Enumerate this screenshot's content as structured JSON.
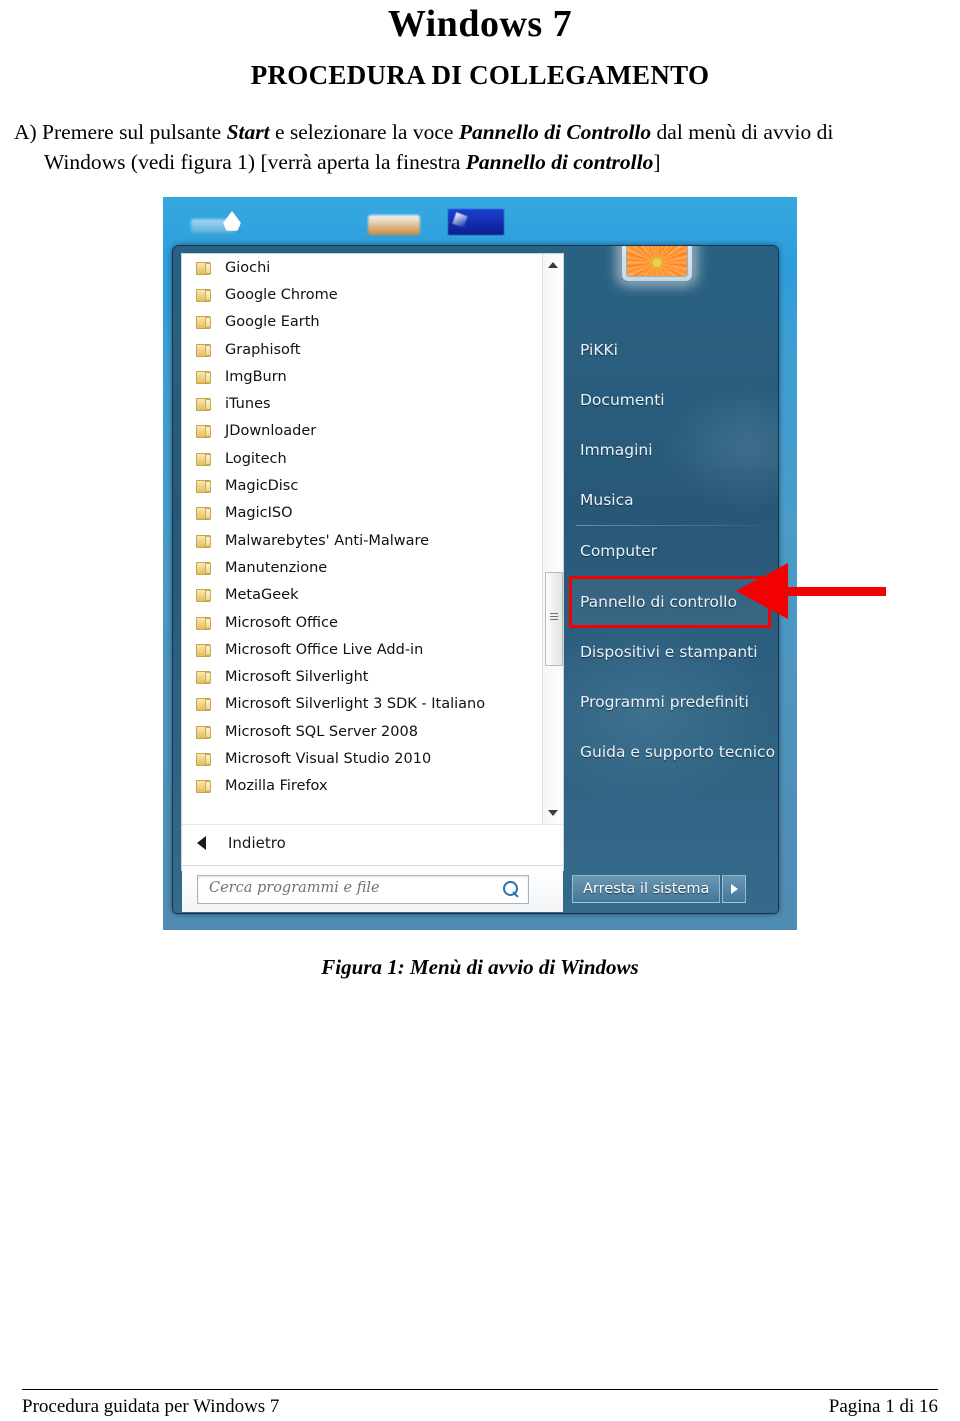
{
  "document": {
    "title": "Windows 7",
    "subtitle": "PROCEDURA DI COLLEGAMENTO",
    "paragraph": {
      "line1_a": "A) Premere sul pulsante ",
      "line1_b": "Start",
      "line1_c": " e selezionare la voce ",
      "line1_d": "Pannello di Controllo",
      "line1_e": " dal menù di avvio di",
      "line2_a": "Windows (vedi figura 1) [verrà aperta la finestra ",
      "line2_b": "Pannello di controllo",
      "line2_c": "]"
    },
    "figure_caption": "Figura 1: Menù di avvio di Windows",
    "footer_left": "Procedura guidata per Windows 7",
    "footer_right": "Pagina 1 di 16"
  },
  "screenshot": {
    "start_menu": {
      "programs": [
        "Giochi",
        "Google Chrome",
        "Google Earth",
        "Graphisoft",
        "ImgBurn",
        "iTunes",
        "JDownloader",
        "Logitech",
        "MagicDisc",
        "MagicISO",
        "Malwarebytes' Anti-Malware",
        "Manutenzione",
        "MetaGeek",
        "Microsoft Office",
        "Microsoft Office Live Add-in",
        "Microsoft Silverlight",
        "Microsoft Silverlight 3 SDK - Italiano",
        "Microsoft SQL Server 2008",
        "Microsoft Visual Studio 2010",
        "Mozilla Firefox"
      ],
      "back_label": "Indietro",
      "search_placeholder": "Cerca programmi e file",
      "right_items": [
        "PiKKi",
        "Documenti",
        "Immagini",
        "Musica",
        "Computer",
        "Pannello di controllo",
        "Dispositivi e stampanti",
        "Programmi predefiniti",
        "Guida e supporto tecnico"
      ],
      "highlighted_item": "Pannello di controllo",
      "shutdown_label": "Arresta il sistema"
    },
    "annotation": {
      "color": "#f30000",
      "points_to": "Pannello di controllo"
    }
  }
}
